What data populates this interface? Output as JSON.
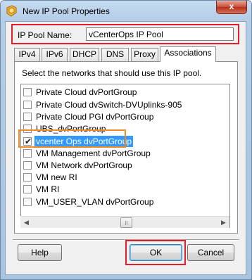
{
  "window": {
    "title": "New IP Pool Properties",
    "close_label": "x",
    "icon": "vmware-pool-icon"
  },
  "pool": {
    "name_label": "IP Pool Name:",
    "name_value": "vCenterOps IP Pool"
  },
  "tabs": [
    {
      "label": "IPv4"
    },
    {
      "label": "IPv6"
    },
    {
      "label": "DHCP"
    },
    {
      "label": "DNS"
    },
    {
      "label": "Proxy"
    },
    {
      "label": "Associations",
      "active": true
    }
  ],
  "associations": {
    "instruction": "Select the networks that should use this IP pool.",
    "networks": [
      {
        "label": "Private Cloud dvPortGroup",
        "checked": false
      },
      {
        "label": "Private Cloud dvSwitch-DVUplinks-905",
        "checked": false
      },
      {
        "label": "Private Cloud PGI dvPortGroup",
        "checked": false
      },
      {
        "label": "UBS_dvPortGroup",
        "checked": false
      },
      {
        "label": "vcenter Ops dvPortGroup",
        "checked": true,
        "selected": true
      },
      {
        "label": "VM Management dvPortGroup",
        "checked": false
      },
      {
        "label": "VM Network dvPortGroup",
        "checked": false
      },
      {
        "label": "VM new RI",
        "checked": false
      },
      {
        "label": "VM RI",
        "checked": false
      },
      {
        "label": "VM_USER_VLAN dvPortGroup",
        "checked": false
      }
    ]
  },
  "buttons": {
    "help": "Help",
    "ok": "OK",
    "cancel": "Cancel"
  },
  "colors": {
    "highlight_red": "#e3202a",
    "highlight_orange": "#f08a24",
    "selection": "#3399ff"
  }
}
